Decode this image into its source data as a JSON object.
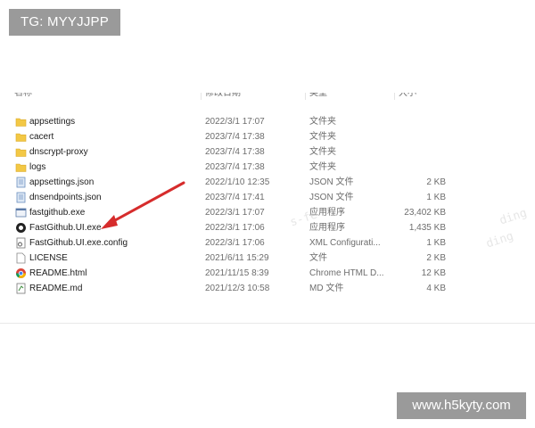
{
  "overlay_tag": "TG: MYYJJPP",
  "site_tag": "www.h5kyty.com",
  "watermarks": [
    "ding",
    "s-fe",
    "ding"
  ],
  "columns": {
    "name": "名称",
    "date": "修改日期",
    "type": "类型",
    "size": "大小"
  },
  "files": [
    {
      "name": "appsettings",
      "date": "2022/3/1 17:07",
      "type": "文件夹",
      "size": "",
      "icon": "folder-icon"
    },
    {
      "name": "cacert",
      "date": "2023/7/4 17:38",
      "type": "文件夹",
      "size": "",
      "icon": "folder-icon"
    },
    {
      "name": "dnscrypt-proxy",
      "date": "2023/7/4 17:38",
      "type": "文件夹",
      "size": "",
      "icon": "folder-icon"
    },
    {
      "name": "logs",
      "date": "2023/7/4 17:38",
      "type": "文件夹",
      "size": "",
      "icon": "folder-icon"
    },
    {
      "name": "appsettings.json",
      "date": "2022/1/10 12:35",
      "type": "JSON 文件",
      "size": "2 KB",
      "icon": "json-file-icon"
    },
    {
      "name": "dnsendpoints.json",
      "date": "2023/7/4 17:41",
      "type": "JSON 文件",
      "size": "1 KB",
      "icon": "json-file-icon"
    },
    {
      "name": "fastgithub.exe",
      "date": "2022/3/1 17:07",
      "type": "应用程序",
      "size": "23,402 KB",
      "icon": "exe-icon"
    },
    {
      "name": "FastGithub.UI.exe",
      "date": "2022/3/1 17:06",
      "type": "应用程序",
      "size": "1,435 KB",
      "icon": "fastgithub-ui-icon"
    },
    {
      "name": "FastGithub.UI.exe.config",
      "date": "2022/3/1 17:06",
      "type": "XML Configurati...",
      "size": "1 KB",
      "icon": "config-file-icon"
    },
    {
      "name": "LICENSE",
      "date": "2021/6/11 15:29",
      "type": "文件",
      "size": "2 KB",
      "icon": "file-icon"
    },
    {
      "name": "README.html",
      "date": "2021/11/15 8:39",
      "type": "Chrome HTML D...",
      "size": "12 KB",
      "icon": "chrome-icon"
    },
    {
      "name": "README.md",
      "date": "2021/12/3 10:58",
      "type": "MD 文件",
      "size": "4 KB",
      "icon": "md-file-icon"
    }
  ],
  "colors": {
    "folder": "#f3c845",
    "arrow": "#d62c2c",
    "tag_bg": "#9a9a9a"
  }
}
